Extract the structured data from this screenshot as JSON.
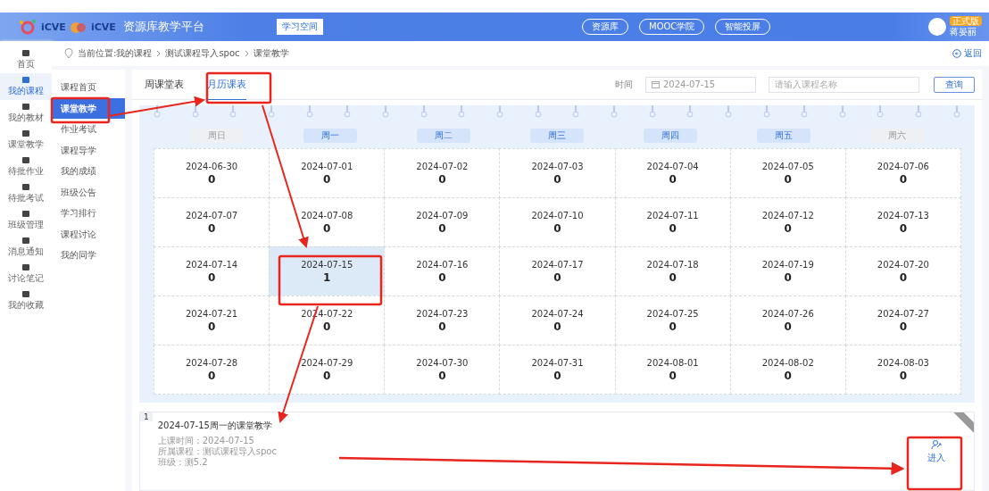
{
  "header": {
    "brand_a": "iCVE",
    "brand_b": "iCVE",
    "platform": "资源库教学平台",
    "space_button": "学习空间",
    "nav_buttons": [
      "资源库",
      "MOOC学院",
      "智能投屏"
    ],
    "user_badge": "正式版",
    "user_name": "蒋晏丽"
  },
  "sidebar": {
    "items": [
      {
        "label": "首页",
        "selected": false
      },
      {
        "label": "我的课程",
        "selected": true
      },
      {
        "label": "我的教材",
        "selected": false
      },
      {
        "label": "课堂教学",
        "selected": false
      },
      {
        "label": "待批作业",
        "selected": false
      },
      {
        "label": "待批考试",
        "selected": false
      },
      {
        "label": "班级管理",
        "selected": false
      },
      {
        "label": "消息通知",
        "selected": false
      },
      {
        "label": "讨论笔记",
        "selected": false
      },
      {
        "label": "我的收藏",
        "selected": false
      }
    ]
  },
  "breadcrumb": {
    "label": "当前位置:我的课程",
    "items": [
      "测试课程导入spoc",
      "课堂教学"
    ],
    "back": "返回"
  },
  "course_menu": {
    "items": [
      {
        "label": "课程首页",
        "selected": false
      },
      {
        "label": "课堂教学",
        "selected": true
      },
      {
        "label": "作业考试",
        "selected": false
      },
      {
        "label": "课程导学",
        "selected": false
      },
      {
        "label": "我的成绩",
        "selected": false
      },
      {
        "label": "班级公告",
        "selected": false
      },
      {
        "label": "学习排行",
        "selected": false
      },
      {
        "label": "课程讨论",
        "selected": false
      },
      {
        "label": "我的同学",
        "selected": false
      }
    ]
  },
  "tabs": [
    {
      "label": "周课堂表",
      "selected": false
    },
    {
      "label": "月历课表",
      "selected": true
    }
  ],
  "filter": {
    "time_label": "时间",
    "date": "2024-07-15",
    "placeholder": "请输入课程名称",
    "query_button": "查询"
  },
  "calendar": {
    "weekdays": [
      {
        "label": "周日",
        "weekend": true
      },
      {
        "label": "周一",
        "weekend": false
      },
      {
        "label": "周二",
        "weekend": false
      },
      {
        "label": "周三",
        "weekend": false
      },
      {
        "label": "周四",
        "weekend": false
      },
      {
        "label": "周五",
        "weekend": false
      },
      {
        "label": "周六",
        "weekend": true
      }
    ],
    "days": [
      {
        "date": "2024-06-30",
        "count": "0",
        "selected": false
      },
      {
        "date": "2024-07-01",
        "count": "0",
        "selected": false
      },
      {
        "date": "2024-07-02",
        "count": "0",
        "selected": false
      },
      {
        "date": "2024-07-03",
        "count": "0",
        "selected": false
      },
      {
        "date": "2024-07-04",
        "count": "0",
        "selected": false
      },
      {
        "date": "2024-07-05",
        "count": "0",
        "selected": false
      },
      {
        "date": "2024-07-06",
        "count": "0",
        "selected": false
      },
      {
        "date": "2024-07-07",
        "count": "0",
        "selected": false
      },
      {
        "date": "2024-07-08",
        "count": "0",
        "selected": false
      },
      {
        "date": "2024-07-09",
        "count": "0",
        "selected": false
      },
      {
        "date": "2024-07-10",
        "count": "0",
        "selected": false
      },
      {
        "date": "2024-07-11",
        "count": "0",
        "selected": false
      },
      {
        "date": "2024-07-12",
        "count": "0",
        "selected": false
      },
      {
        "date": "2024-07-13",
        "count": "0",
        "selected": false
      },
      {
        "date": "2024-07-14",
        "count": "0",
        "selected": false
      },
      {
        "date": "2024-07-15",
        "count": "1",
        "selected": true
      },
      {
        "date": "2024-07-16",
        "count": "0",
        "selected": false
      },
      {
        "date": "2024-07-17",
        "count": "0",
        "selected": false
      },
      {
        "date": "2024-07-18",
        "count": "0",
        "selected": false
      },
      {
        "date": "2024-07-19",
        "count": "0",
        "selected": false
      },
      {
        "date": "2024-07-20",
        "count": "0",
        "selected": false
      },
      {
        "date": "2024-07-21",
        "count": "0",
        "selected": false
      },
      {
        "date": "2024-07-22",
        "count": "0",
        "selected": false
      },
      {
        "date": "2024-07-23",
        "count": "0",
        "selected": false
      },
      {
        "date": "2024-07-24",
        "count": "0",
        "selected": false
      },
      {
        "date": "2024-07-25",
        "count": "0",
        "selected": false
      },
      {
        "date": "2024-07-26",
        "count": "0",
        "selected": false
      },
      {
        "date": "2024-07-27",
        "count": "0",
        "selected": false
      },
      {
        "date": "2024-07-28",
        "count": "0",
        "selected": false
      },
      {
        "date": "2024-07-29",
        "count": "0",
        "selected": false
      },
      {
        "date": "2024-07-30",
        "count": "0",
        "selected": false
      },
      {
        "date": "2024-07-31",
        "count": "0",
        "selected": false
      },
      {
        "date": "2024-08-01",
        "count": "0",
        "selected": false
      },
      {
        "date": "2024-08-02",
        "count": "0",
        "selected": false
      },
      {
        "date": "2024-08-03",
        "count": "0",
        "selected": false
      }
    ]
  },
  "lessons": [
    {
      "index": "1",
      "title": "2024-07-15周一的课堂教学",
      "details": [
        "上课时间：2024-07-15",
        "所属课程：测试课程导入spoc",
        "班级：测5.2"
      ],
      "enter": "进入"
    }
  ]
}
